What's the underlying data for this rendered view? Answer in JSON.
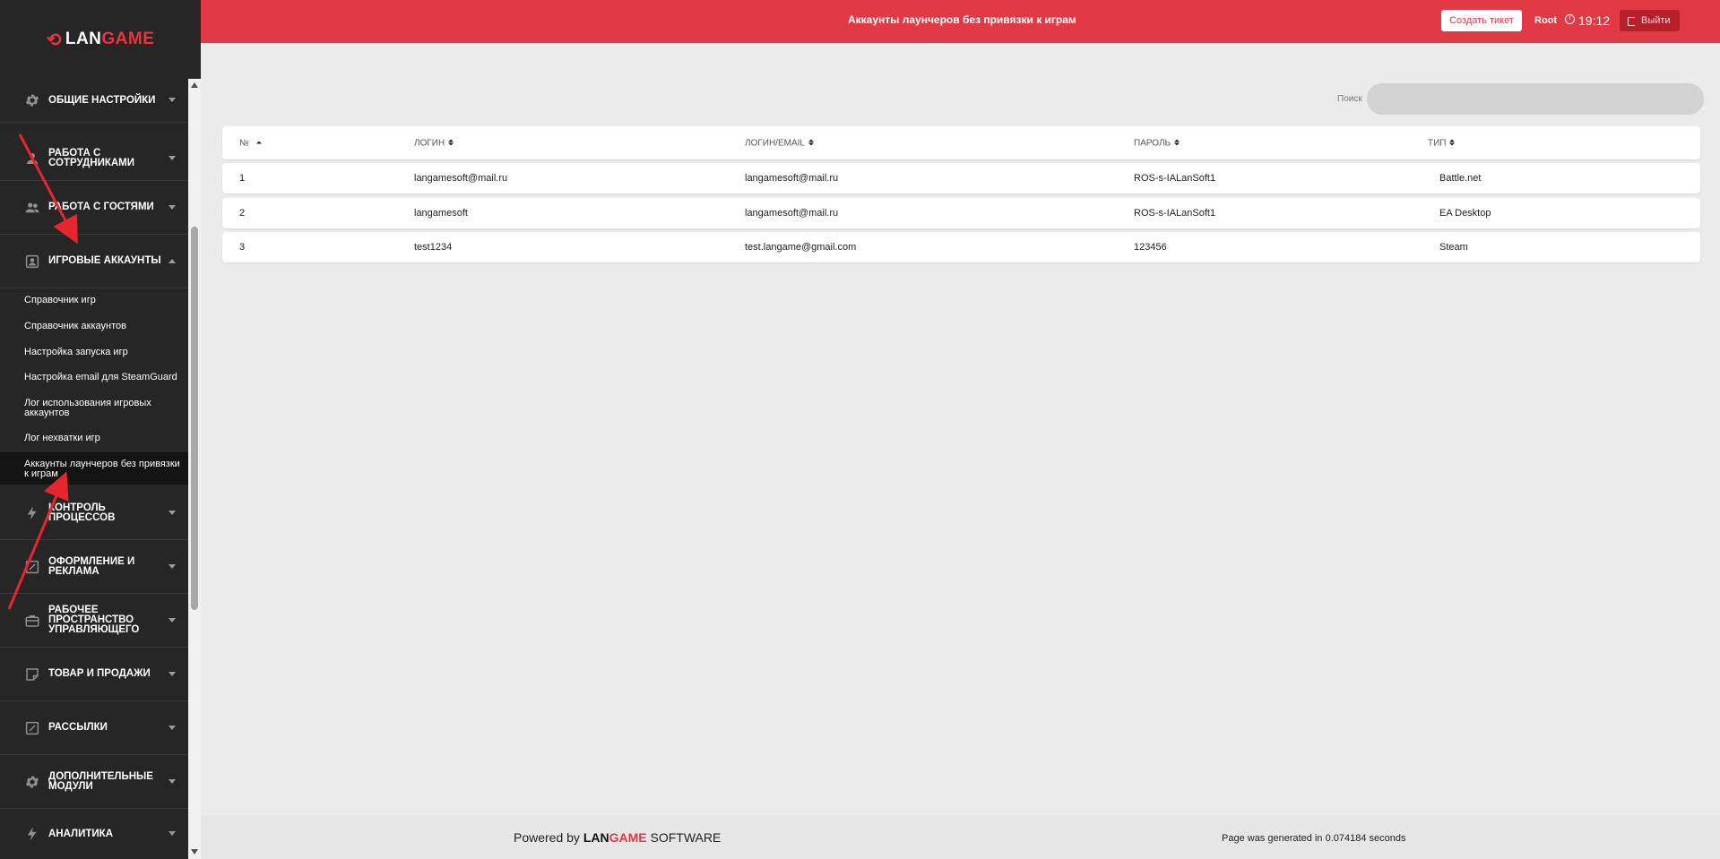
{
  "brand": {
    "mark": "⟲",
    "part1": "LAN",
    "part2": "GAME"
  },
  "header": {
    "title": "Аккаунты лаунчеров без привязки к играм",
    "ticket_button": "Создать тикет",
    "user": "Root",
    "time": "19:12",
    "logout": "Выйти"
  },
  "sidebar": {
    "sections": [
      {
        "label": "Общие настройки",
        "icon": "gear-icon"
      },
      {
        "label": "Работа с сотрудниками",
        "icon": "user-icon"
      },
      {
        "label": "Работа с гостями",
        "icon": "users-icon"
      },
      {
        "label": "Игровые аккаунты",
        "icon": "account-box-icon"
      },
      {
        "label": "Контроль процессов",
        "icon": "lightning-icon"
      },
      {
        "label": "Оформление и реклама",
        "icon": "edit-icon"
      },
      {
        "label": "Рабочее пространство управляющего",
        "icon": "briefcase-icon"
      },
      {
        "label": "Товар и продажи",
        "icon": "sticky-note-icon"
      },
      {
        "label": "Рассылки",
        "icon": "edit-icon"
      },
      {
        "label": "Дополнительные модули",
        "icon": "gear-icon"
      },
      {
        "label": "Аналитика",
        "icon": "lightning-icon"
      }
    ],
    "sub_items": [
      "Справочник игр",
      "Справочник аккаунтов",
      "Настройка запуска игр",
      "Настройка email для SteamGuard",
      "Лог использования игровых аккаунтов",
      "Лог нехватки игр",
      "Аккаунты лаунчеров без привязки к играм"
    ]
  },
  "search": {
    "label": "Поиск",
    "value": ""
  },
  "table": {
    "headers": [
      "№",
      "Логин",
      "Логин/Email",
      "Пароль",
      "Тип"
    ],
    "rows": [
      [
        "1",
        "langamesoft@mail.ru",
        "langamesoft@mail.ru",
        "ROS-s-IALanSoft1",
        "Battle.net"
      ],
      [
        "2",
        "langamesoft",
        "langamesoft@mail.ru",
        "ROS-s-IALanSoft1",
        "EA Desktop"
      ],
      [
        "3",
        "test1234",
        "test.langame@gmail.com",
        "123456",
        "Steam"
      ]
    ]
  },
  "footer": {
    "powered_prefix": "Powered by",
    "brand1": "LAN",
    "brand2": "GAME",
    "powered_suffix": "SOFTWARE",
    "generated": "Page was generated in 0.074184 seconds"
  },
  "colors": {
    "accent": "#e23a45",
    "sidebar": "#262626",
    "background": "#ebebeb"
  }
}
